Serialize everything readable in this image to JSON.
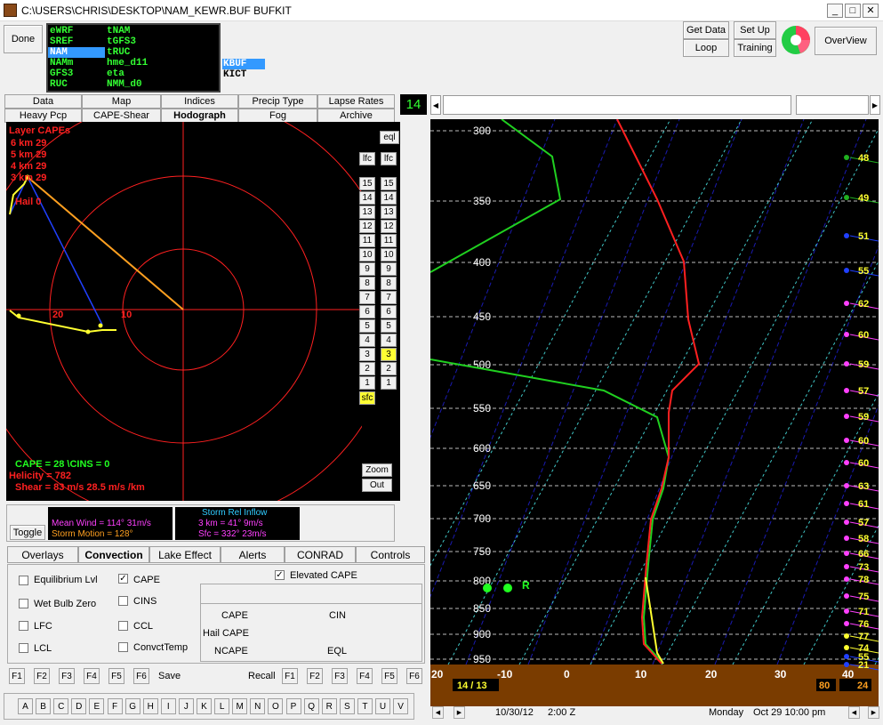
{
  "window": {
    "title": "C:\\USERS\\CHRIS\\DESKTOP\\NAM_KEWR.BUF BUFKIT"
  },
  "toolbar": {
    "done": "Done",
    "get_data": "Get Data",
    "loop": "Loop",
    "set_up": "Set Up",
    "training": "Training",
    "overview": "OverView"
  },
  "models": {
    "col1": [
      "eWRF",
      "SREF",
      "NAM",
      "NAMm",
      "GFS3",
      "RUC"
    ],
    "col2": [
      "tNAM",
      "tGFS3",
      "tRUC",
      "hme_d11",
      "eta",
      "NMM_d0"
    ],
    "selected": "NAM"
  },
  "stations": {
    "items": [
      "KBUF",
      "KICT"
    ],
    "selected": "KBUF"
  },
  "tabs_row1": [
    "Data",
    "Map",
    "Indices",
    "Precip Type",
    "Lapse Rates"
  ],
  "tabs_row2": [
    "Heavy Pcp",
    "CAPE-Shear",
    "Hodograph",
    "Fog",
    "Archive"
  ],
  "active_tab": "Hodograph",
  "frame_number": "14",
  "hodograph": {
    "layer_title": "Layer CAPEs",
    "layer_lines": [
      "6 km  29",
      "5 km  29",
      "4 km  29",
      "3 km  29"
    ],
    "hail": "Hail  0",
    "ring_labels": [
      "20",
      "10"
    ],
    "cape_line": "CAPE = 28 \\CINS = 0",
    "helicity": "Helicity = 782",
    "shear": "Shear = 83 m/s   28.5 m/s /km",
    "eql": "eql",
    "lfc": "lfc",
    "sfc": "sfc",
    "layer_numbers": [
      "15",
      "14",
      "13",
      "12",
      "11",
      "10",
      "9",
      "8",
      "7",
      "6",
      "5",
      "4",
      "3",
      "2",
      "1"
    ],
    "highlight": "3",
    "zoom": "Zoom",
    "out": "Out"
  },
  "wind_info": {
    "toggle": "Toggle",
    "mean_wind": "Mean Wind = 114°  31m/s",
    "storm_motion": "Storm Motion = 128°",
    "inflow_title": "Storm Rel Inflow",
    "inflow_3km": "3 km = 41°  9m/s",
    "inflow_sfc": "Sfc = 332°  23m/s"
  },
  "lower_tabs": [
    "Overlays",
    "Convection",
    "Lake Effect",
    "Alerts",
    "CONRAD",
    "Controls"
  ],
  "active_lower_tab": "Convection",
  "convection": {
    "checks_left": [
      "Equilibrium Lvl",
      "Wet Bulb Zero",
      "LFC",
      "LCL"
    ],
    "checks_right": [
      "CAPE",
      "CINS",
      "CCL",
      "ConvctTemp"
    ],
    "elevated": "Elevated CAPE",
    "results": [
      "CAPE",
      "CIN",
      "Hail CAPE",
      "NCAPE",
      "EQL"
    ]
  },
  "fkeys": {
    "left": [
      "F1",
      "F2",
      "F3",
      "F4",
      "F5",
      "F6"
    ],
    "save": "Save",
    "recall": "Recall",
    "right": [
      "F1",
      "F2",
      "F3",
      "F4",
      "F5",
      "F6"
    ]
  },
  "letters": [
    "A",
    "B",
    "C",
    "D",
    "E",
    "F",
    "G",
    "H",
    "I",
    "J",
    "K",
    "L",
    "M",
    "N",
    "O",
    "P",
    "Q",
    "R",
    "S",
    "T",
    "U",
    "V"
  ],
  "sounding": {
    "pressure_levels": [
      "300",
      "350",
      "400",
      "450",
      "500",
      "550",
      "600",
      "650",
      "700",
      "750",
      "800",
      "850",
      "900",
      "950"
    ],
    "temp_ticks": [
      "20",
      "-10",
      "0",
      "10",
      "20",
      "30",
      "40"
    ],
    "right_values": [
      "48",
      "49",
      "51",
      "55",
      "62",
      "60",
      "59",
      "57",
      "59",
      "60",
      "60",
      "63",
      "61",
      "57",
      "58",
      "66",
      "73",
      "78",
      "75",
      "71",
      "76",
      "77",
      "74",
      "55",
      "21"
    ],
    "sfc_temp": "14 / 13",
    "box_left": "80",
    "box_right": "24",
    "parcel_mark": "R",
    "colors": {
      "temperature": "#ff2020",
      "dewpoint": "#20d020",
      "virtual": "#ffff30",
      "brown": "#7a3c00"
    }
  },
  "status": {
    "date": "10/30/12",
    "time": "2:00 Z",
    "day": "Monday",
    "local": "Oct 29  10:00 pm"
  }
}
